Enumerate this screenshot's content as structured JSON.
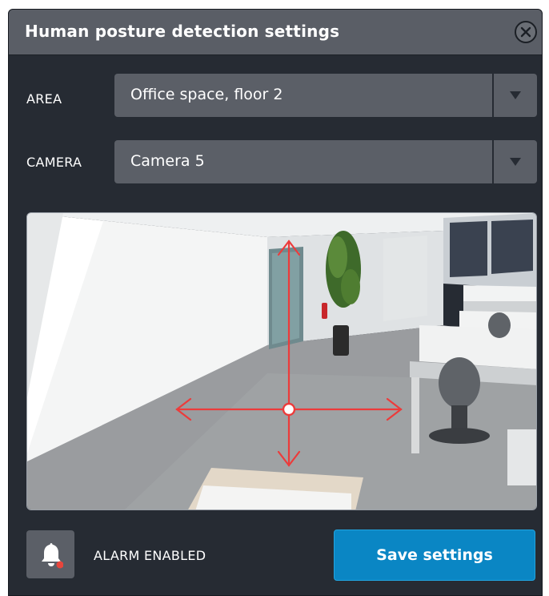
{
  "dialog": {
    "title": "Human posture detection settings",
    "close_icon": "close-circle-icon"
  },
  "area": {
    "label": "AREA",
    "value": "Office space, floor 2",
    "arrow_icon": "triangle-down-icon"
  },
  "camera": {
    "label": "CAMERA",
    "value": "Camera 5",
    "arrow_icon": "triangle-down-icon"
  },
  "preview": {
    "overlay_icon": "move-crosshair-icon",
    "overlay_color": "#ec3b3b"
  },
  "alarm": {
    "icon": "bell-icon",
    "status_dot_color": "#e8453c",
    "label": "ALARM ENABLED"
  },
  "actions": {
    "save_label": "Save settings",
    "save_color": "#0a86c4"
  }
}
